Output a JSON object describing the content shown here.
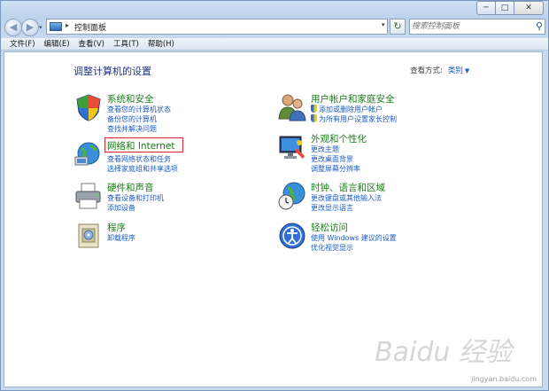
{
  "window": {
    "minimize": "─",
    "maximize": "□",
    "close": "✕"
  },
  "nav": {
    "back": "◀",
    "forward": "▶",
    "dropdown": "▾"
  },
  "address": {
    "separator": "▸",
    "path": "控制面板",
    "chevron": "▾"
  },
  "refresh_glyph": "↻",
  "search": {
    "placeholder": "搜索控制面板",
    "glyph": "⚲"
  },
  "menu": [
    "文件(F)",
    "编辑(E)",
    "查看(V)",
    "工具(T)",
    "帮助(H)"
  ],
  "page_title": "调整计算机的设置",
  "view_by": {
    "label": "查看方式:",
    "value": "类别"
  },
  "categories": [
    {
      "title": "系统和安全",
      "icon": "shield-icon",
      "links": [
        "查看您的计算机状态",
        "备份您的计算机",
        "查找并解决问题"
      ]
    },
    {
      "title": "网络和 Internet",
      "icon": "network-icon",
      "links": [
        "查看网络状态和任务",
        "选择家庭组和共享选项"
      ]
    },
    {
      "title": "硬件和声音",
      "icon": "printer-icon",
      "links": [
        "查看设备和打印机",
        "添加设备"
      ]
    },
    {
      "title": "程序",
      "icon": "programs-icon",
      "links": [
        "卸载程序"
      ]
    },
    {
      "title": "用户帐户和家庭安全",
      "icon": "users-icon",
      "links": [
        "添加或删除用户帐户",
        "为所有用户设置家长控制"
      ]
    },
    {
      "title": "外观和个性化",
      "icon": "monitor-icon",
      "links": [
        "更改主题",
        "更改桌面背景",
        "调整屏幕分辨率"
      ]
    },
    {
      "title": "时钟、语言和区域",
      "icon": "globe-clock-icon",
      "links": [
        "更改键盘或其他输入法",
        "更改显示语言"
      ]
    },
    {
      "title": "轻松访问",
      "icon": "accessibility-icon",
      "links": [
        "使用 Windows 建议的设置",
        "优化视觉显示"
      ]
    }
  ],
  "watermark": {
    "logo": "Baidu 经验",
    "url": "jingyan.baidu.com"
  },
  "colors": {
    "category_title": "#1a7d1a",
    "link": "#1a5cc5",
    "heading": "#1e3287",
    "highlight": "#e0262b"
  }
}
